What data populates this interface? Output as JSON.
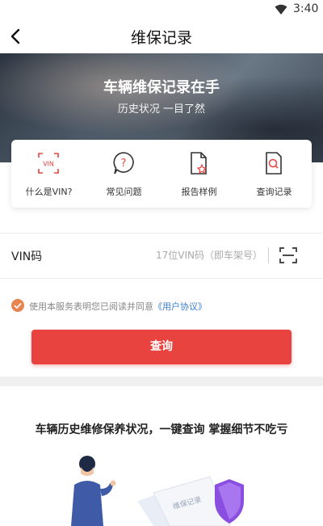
{
  "status_bar": {
    "time": "3:40",
    "wifi_icon": "wifi-icon"
  },
  "nav": {
    "title": "维保记录",
    "back_icon": "chevron-left-icon"
  },
  "hero": {
    "title": "车辆维保记录在手",
    "subtitle": "历史状况 一目了然"
  },
  "quick_links": [
    {
      "label": "什么是VIN?",
      "icon": "vin-frame-icon"
    },
    {
      "label": "常见问题",
      "icon": "question-bubble-icon"
    },
    {
      "label": "报告样例",
      "icon": "report-star-icon"
    },
    {
      "label": "查询记录",
      "icon": "search-document-icon"
    }
  ],
  "vin": {
    "label": "VIN码",
    "placeholder": "17位VIN码（即车架号）",
    "value": "",
    "scan_icon": "scan-icon"
  },
  "agreement": {
    "text": "使用本服务表明您已阅读并同意",
    "link": "《用户协议》",
    "checked": true
  },
  "query_button": "查询",
  "promo": {
    "title": "车辆历史维修保养状况，一键查询 掌握细节不吃亏",
    "card_text": "维保记录"
  },
  "colors": {
    "accent": "#e8433f",
    "check": "#e8844f",
    "link": "#3d7fd1"
  }
}
